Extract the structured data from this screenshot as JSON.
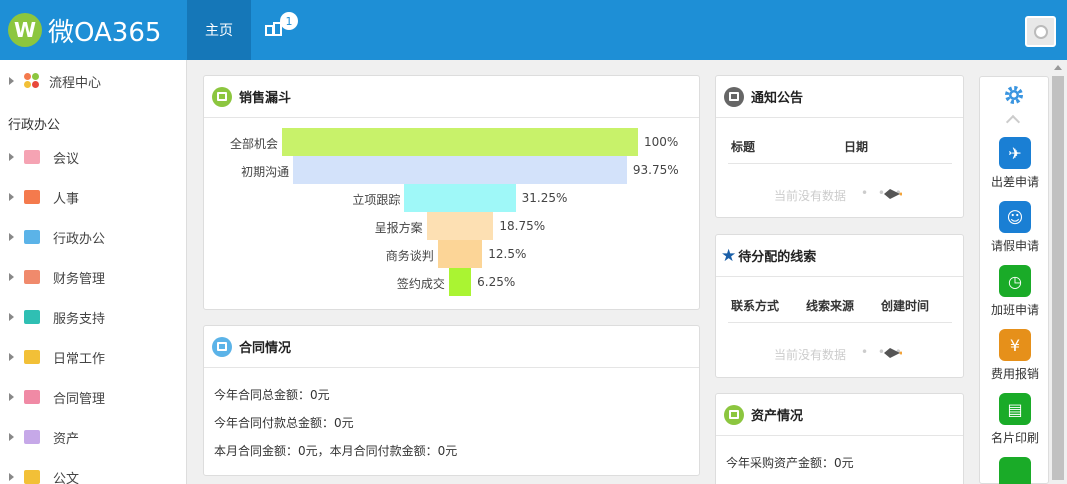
{
  "header": {
    "logo_letter": "W",
    "logo_text": "微OA365",
    "nav_home": "主页",
    "notification_count": "1"
  },
  "sidebar": {
    "top_item": "流程中心",
    "section": "行政办公",
    "items": [
      {
        "label": "会议",
        "icon": "meeting-icon",
        "color": "#f5a3b3"
      },
      {
        "label": "人事",
        "icon": "personnel-icon",
        "color": "#f47a4d"
      },
      {
        "label": "行政办公",
        "icon": "admin-icon",
        "color": "#5bb3e8"
      },
      {
        "label": "财务管理",
        "icon": "finance-icon",
        "color": "#f08a6c"
      },
      {
        "label": "服务支持",
        "icon": "support-icon",
        "color": "#2fbfb3"
      },
      {
        "label": "日常工作",
        "icon": "daily-icon",
        "color": "#f2c037"
      },
      {
        "label": "合同管理",
        "icon": "contract-icon",
        "color": "#f08aa5"
      },
      {
        "label": "资产",
        "icon": "asset-icon",
        "color": "#c6a8e8"
      },
      {
        "label": "公文",
        "icon": "document-icon",
        "color": "#f2c037"
      }
    ]
  },
  "sales_funnel": {
    "title": "销售漏斗",
    "chart_data": {
      "type": "bar",
      "categories": [
        "全部机会",
        "初期沟通",
        "立项跟踪",
        "呈报方案",
        "商务谈判",
        "签约成交"
      ],
      "values": [
        100,
        93.75,
        31.25,
        18.75,
        12.5,
        6.25
      ],
      "labels": [
        "100%",
        "93.75%",
        "31.25%",
        "18.75%",
        "12.5%",
        "6.25%"
      ],
      "colors": [
        "#c8f26a",
        "#d3e2fa",
        "#9ff8f8",
        "#fde0b3",
        "#fcd597",
        "#aaf432"
      ]
    }
  },
  "contract": {
    "title": "合同情况",
    "line1": "今年合同总金额：0元",
    "line2": "今年合同付款总金额：0元",
    "line3": "本月合同金额：0元，本月合同付款金额：0元"
  },
  "notice": {
    "title": "通知公告",
    "col_title": "标题",
    "col_date": "日期",
    "empty": "当前没有数据"
  },
  "leads": {
    "title": "待分配的线索",
    "col1": "联系方式",
    "col2": "线索来源",
    "col3": "创建时间",
    "empty": "当前没有数据"
  },
  "assets": {
    "title": "资产情况",
    "line1": "今年采购资产金额：0元"
  },
  "quick_apps": [
    {
      "label": "出差申请",
      "icon": "airplane-icon",
      "color": "#1a7fd4"
    },
    {
      "label": "请假申请",
      "icon": "leave-icon",
      "color": "#1a7fd4"
    },
    {
      "label": "加班申请",
      "icon": "clock-icon",
      "color": "#1aab28"
    },
    {
      "label": "费用报销",
      "icon": "expense-icon",
      "color": "#e6901a"
    },
    {
      "label": "名片印刷",
      "icon": "card-icon",
      "color": "#1aab28"
    }
  ]
}
